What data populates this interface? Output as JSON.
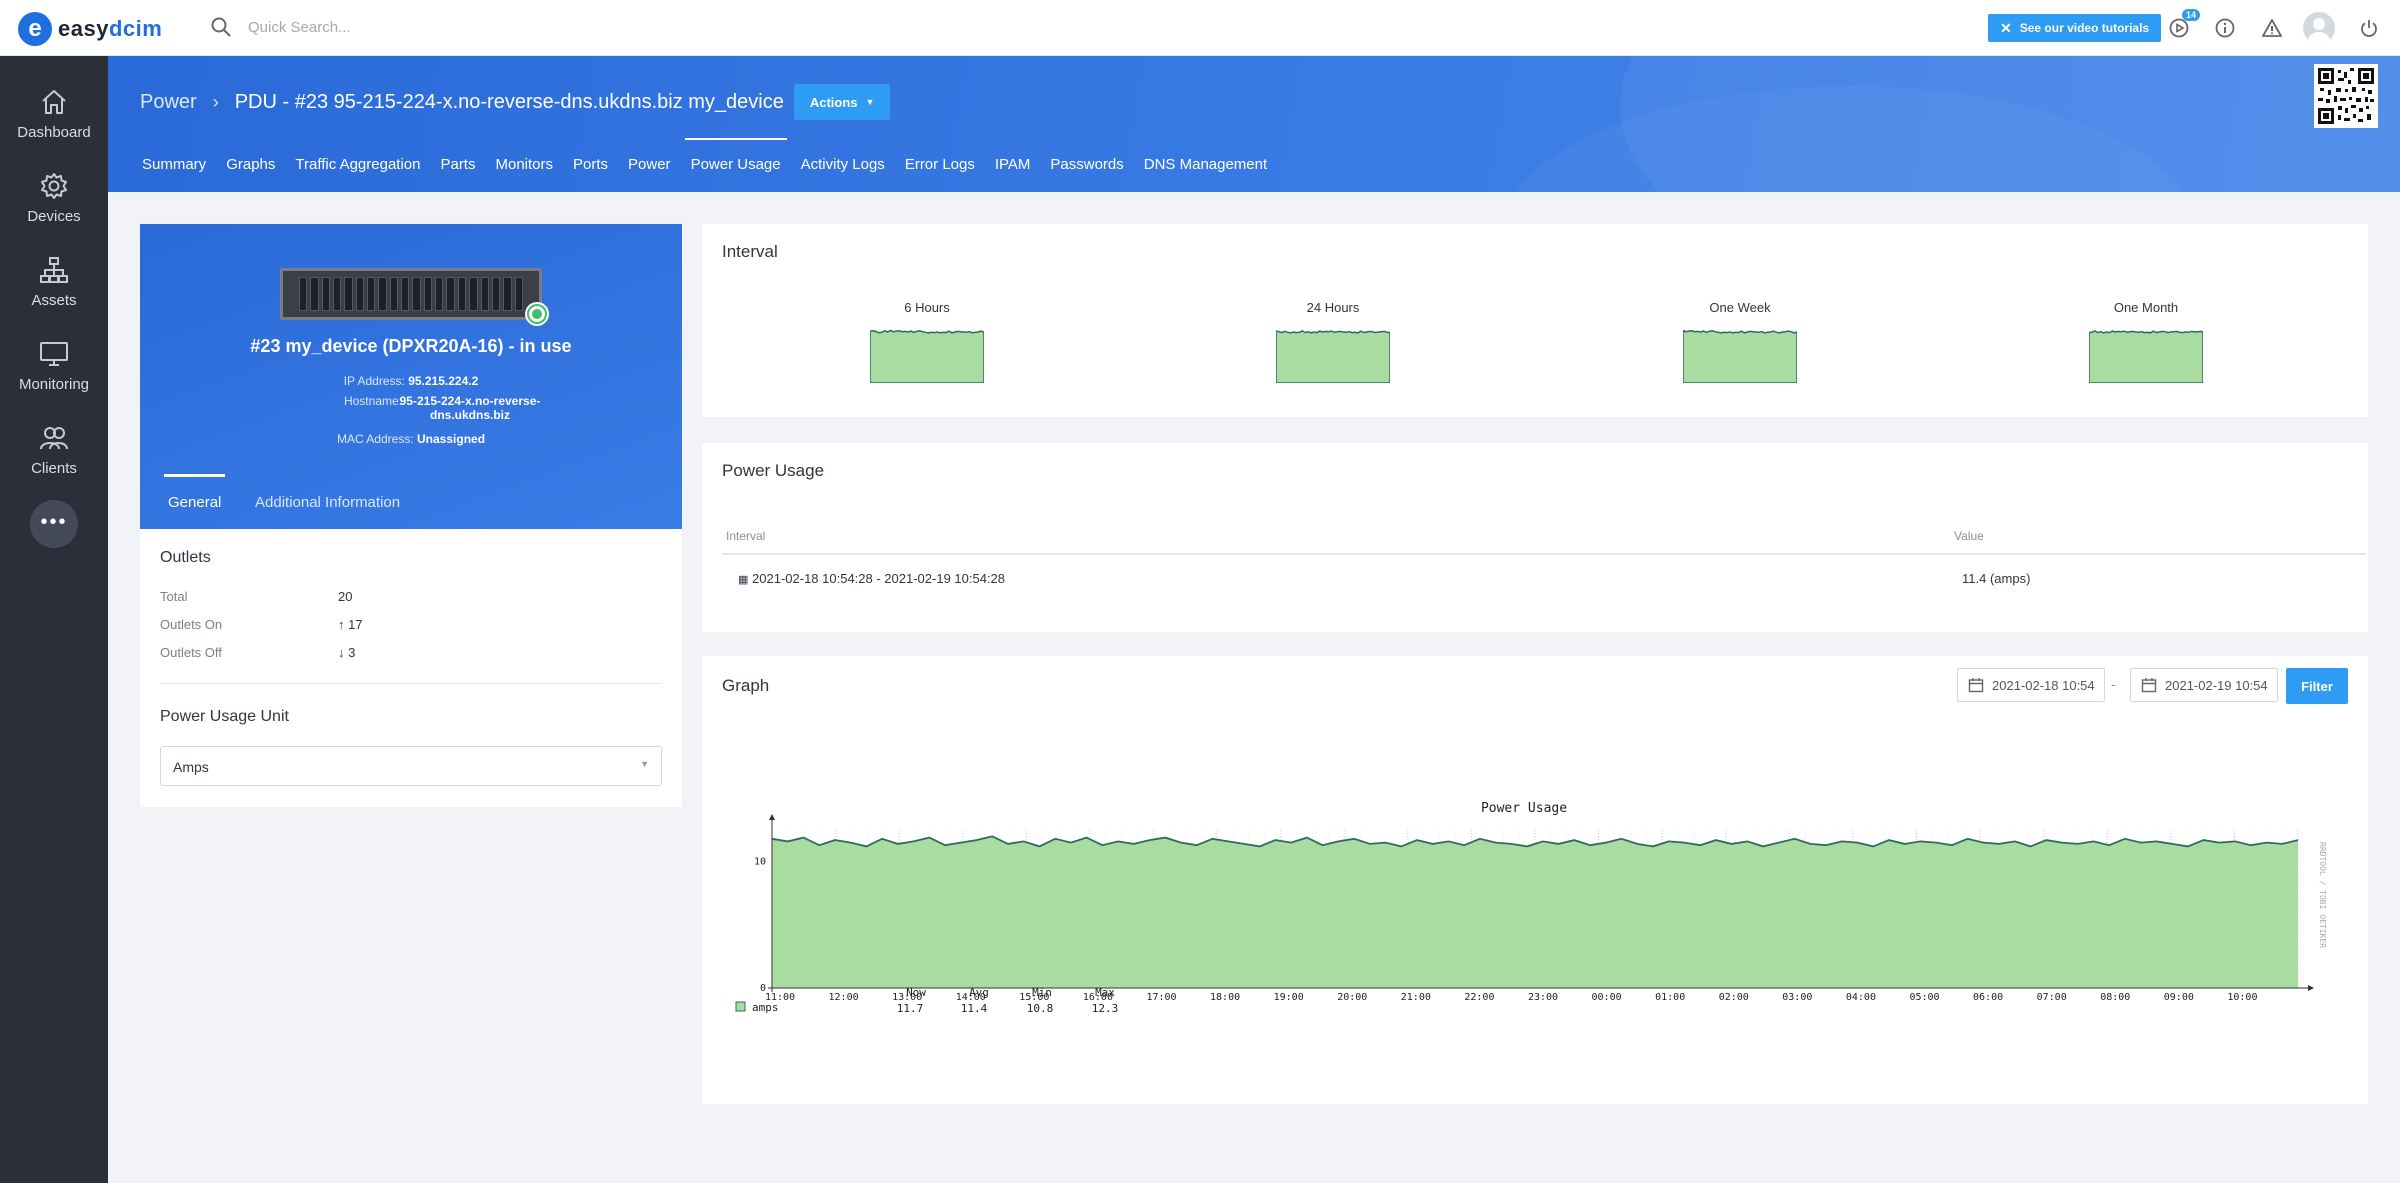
{
  "app": {
    "logo_letter": "e",
    "logo_word_a": "easy",
    "logo_word_b": "dcim",
    "search_placeholder": "Quick Search...",
    "tutorial_label": "See our video tutorials",
    "notifications_count": "14",
    "brand_color": "#1e6fe0",
    "accent_color": "#2d9cf2"
  },
  "sidebar": {
    "items": [
      {
        "label": "Dashboard",
        "icon": "home-icon"
      },
      {
        "label": "Devices",
        "icon": "gear-icon"
      },
      {
        "label": "Assets",
        "icon": "hierarchy-icon"
      },
      {
        "label": "Monitoring",
        "icon": "monitor-icon"
      },
      {
        "label": "Clients",
        "icon": "users-icon"
      }
    ],
    "more_label": "•••"
  },
  "header": {
    "breadcrumb_root": "Power",
    "title": "PDU - #23 95-215-224-x.no-reverse-dns.ukdns.biz my_device",
    "actions_label": "Actions",
    "tabs": [
      "Summary",
      "Graphs",
      "Traffic Aggregation",
      "Parts",
      "Monitors",
      "Ports",
      "Power",
      "Power Usage",
      "Activity Logs",
      "Error Logs",
      "IPAM",
      "Passwords",
      "DNS Management"
    ],
    "active_tab": "Power Usage"
  },
  "device": {
    "name": "#23 my_device (DPXR20A-16) - in use",
    "ip_label": "IP Address:",
    "ip": "95.215.224.2",
    "hostname_label": "Hostname:",
    "hostname_line1": "95-215-224-x.no-reverse-",
    "hostname_line2": "dns.ukdns.biz",
    "mac_label": "MAC Address:",
    "mac": "Unassigned",
    "tabs": [
      "General",
      "Additional Information"
    ]
  },
  "outlets": {
    "title": "Outlets",
    "rows": [
      {
        "label": "Total",
        "value": "20"
      },
      {
        "label": "Outlets On",
        "value": "↑ 17"
      },
      {
        "label": "Outlets Off",
        "value": "↓ 3"
      }
    ]
  },
  "unit": {
    "title": "Power Usage Unit",
    "selected": "Amps"
  },
  "interval": {
    "title": "Interval",
    "options": [
      "6 Hours",
      "24 Hours",
      "One Week",
      "One Month"
    ]
  },
  "power_usage": {
    "title": "Power Usage",
    "col_interval": "Interval",
    "col_value": "Value",
    "row_interval": "2021-02-18 10:54:28 - 2021-02-19 10:54:28",
    "row_value": "11.4 (amps)"
  },
  "graph": {
    "title": "Graph",
    "date_from": "2021-02-18 10:54",
    "date_to": "2021-02-19 10:54",
    "separator": "-",
    "filter_label": "Filter",
    "side_label": "RRDTOOL / TOBI OETIKER",
    "legend_series": "amps",
    "stats": {
      "labels": [
        "Now",
        "Avg",
        "Min",
        "Max"
      ],
      "values": [
        "11.7",
        "11.4",
        "10.8",
        "12.3"
      ]
    }
  },
  "chart_data": {
    "type": "area",
    "title": "Power Usage",
    "ylim": [
      0,
      12.5
    ],
    "y_ticks": [
      "0",
      "10"
    ],
    "x_ticks": [
      "11:00",
      "12:00",
      "13:00",
      "14:00",
      "15:00",
      "16:00",
      "17:00",
      "18:00",
      "19:00",
      "20:00",
      "21:00",
      "22:00",
      "23:00",
      "00:00",
      "01:00",
      "02:00",
      "03:00",
      "04:00",
      "05:00",
      "06:00",
      "07:00",
      "08:00",
      "09:00",
      "10:00"
    ],
    "series": [
      {
        "name": "amps",
        "color": "#a8dca0",
        "values": [
          11.8,
          11.6,
          11.9,
          11.3,
          11.7,
          11.5,
          11.2,
          11.8,
          11.4,
          11.6,
          11.9,
          11.3,
          11.5,
          11.7,
          12.0,
          11.4,
          11.6,
          11.2,
          11.8,
          11.5,
          11.9,
          11.3,
          11.6,
          11.4,
          11.7,
          11.9,
          11.5,
          11.3,
          11.8,
          11.6,
          11.4,
          11.2,
          11.7,
          11.5,
          11.9,
          11.3,
          11.6,
          11.8,
          11.4,
          11.5,
          11.2,
          11.7,
          11.4,
          11.6,
          11.3,
          11.8,
          11.5,
          11.4,
          11.2,
          11.6,
          11.4,
          11.7,
          11.3,
          11.5,
          11.8,
          11.4,
          11.2,
          11.6,
          11.5,
          11.3,
          11.7,
          11.4,
          11.6,
          11.2,
          11.5,
          11.8,
          11.4,
          11.3,
          11.6,
          11.5,
          11.2,
          11.7,
          11.4,
          11.6,
          11.5,
          11.3,
          11.8,
          11.5,
          11.4,
          11.6,
          11.2,
          11.7,
          11.5,
          11.4,
          11.6,
          11.3,
          11.8,
          11.5,
          11.6,
          11.4,
          11.2,
          11.7,
          11.5,
          11.6,
          11.3,
          11.5,
          11.4,
          11.7
        ]
      }
    ]
  }
}
